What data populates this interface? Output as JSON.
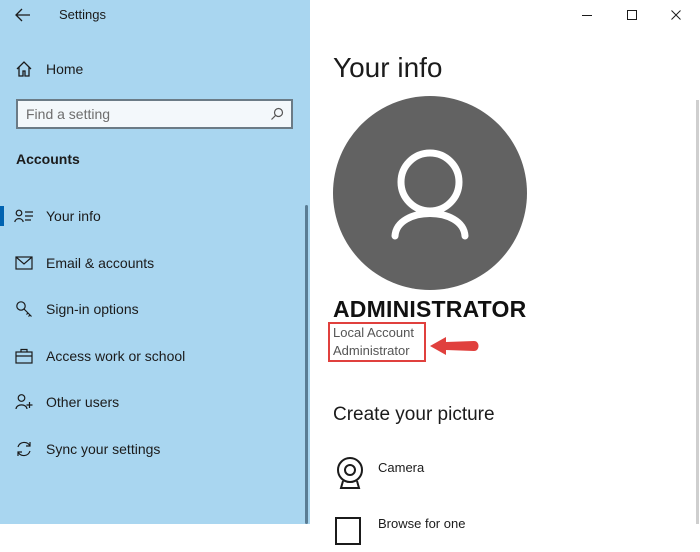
{
  "window": {
    "app_title": "Settings",
    "controls": [
      "minimize",
      "maximize",
      "close"
    ]
  },
  "sidebar": {
    "home_label": "Home",
    "search_placeholder": "Find a setting",
    "section_title": "Accounts",
    "items": [
      {
        "label": "Your info",
        "icon": "person-card-icon",
        "active": true
      },
      {
        "label": "Email & accounts",
        "icon": "mail-icon",
        "active": false
      },
      {
        "label": "Sign-in options",
        "icon": "key-icon",
        "active": false
      },
      {
        "label": "Access work or school",
        "icon": "briefcase-icon",
        "active": false
      },
      {
        "label": "Other users",
        "icon": "person-add-icon",
        "active": false
      },
      {
        "label": "Sync your settings",
        "icon": "sync-icon",
        "active": false
      }
    ]
  },
  "main": {
    "page_title": "Your info",
    "user_name": "ADMINISTRATOR",
    "account_type_line1": "Local Account",
    "account_type_line2": "Administrator",
    "create_picture_title": "Create your picture",
    "picture_options": [
      {
        "label": "Camera",
        "icon": "camera-icon"
      },
      {
        "label": "Browse for one",
        "icon": "browse-icon"
      }
    ]
  },
  "colors": {
    "sidebar_bg": "#a9d6f0",
    "accent": "#0063b1",
    "avatar_bg": "#626262",
    "highlight_red": "#e0403d"
  }
}
